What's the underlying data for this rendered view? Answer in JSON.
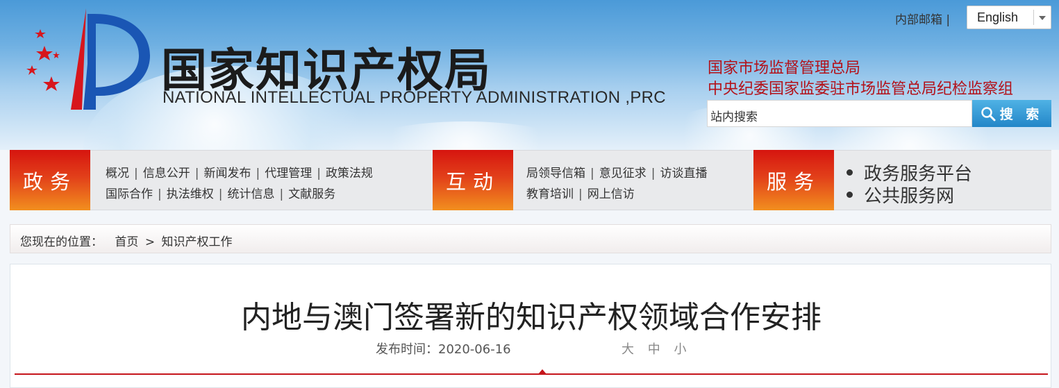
{
  "header": {
    "logo_cn": "国家知识产权局",
    "logo_en": "NATIONAL INTELLECTUAL PROPERTY ADMINISTRATION ,PRC",
    "internal_mail": "内部邮箱 |",
    "language": "English",
    "org_line_1": "国家市场监督管理总局",
    "org_line_2": "中央纪委国家监委驻市场监管总局纪检监察组",
    "search_placeholder": "站内搜索",
    "search_button": "搜 索",
    "colors": {
      "org_red": "#b3121a",
      "search_blue": "#2386c8"
    }
  },
  "nav": {
    "gov": {
      "label": "政务",
      "row1": [
        "概况",
        "信息公开",
        "新闻发布",
        "代理管理",
        "政策法规"
      ],
      "row2": [
        "国际合作",
        "执法维权",
        "统计信息",
        "文献服务"
      ]
    },
    "interact": {
      "label": "互动",
      "row1": [
        "局领导信箱",
        "意见征求",
        "访谈直播"
      ],
      "row2": [
        "教育培训",
        "网上信访"
      ]
    },
    "service": {
      "label": "服务",
      "items": [
        "政务服务平台",
        "公共服务网"
      ]
    },
    "colors": {
      "block_top": "#d6150f",
      "block_bottom": "#f28f1e"
    }
  },
  "breadcrumb": {
    "prefix": "您现在的位置：",
    "home": "首页",
    "separator": ">",
    "current": "知识产权工作"
  },
  "article": {
    "title": "内地与澳门签署新的知识产权领域合作安排",
    "publish_label": "发布时间：2020-06-16",
    "font_large": "大",
    "font_medium": "中",
    "font_small": "小"
  }
}
